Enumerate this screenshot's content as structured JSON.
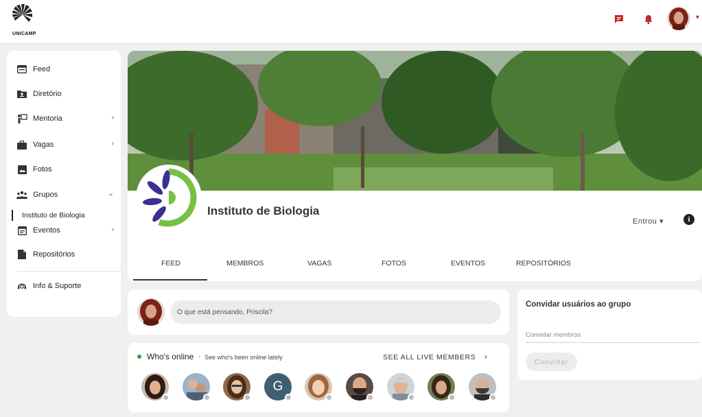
{
  "brand": {
    "name": "UNICAMP",
    "logo_icon": "unicamp-logo-icon"
  },
  "header": {
    "messages_icon": "chat-icon",
    "notifications_icon": "bell-icon",
    "accent_color": "#c62828"
  },
  "sidebar": {
    "items": [
      {
        "label": "Feed",
        "icon": "feed-icon",
        "chevron": false
      },
      {
        "label": "Diretório",
        "icon": "directory-icon",
        "chevron": false
      },
      {
        "label": "Mentoria",
        "icon": "mentoring-icon",
        "chevron": true
      },
      {
        "label": "Vagas",
        "icon": "briefcase-icon",
        "chevron": true
      },
      {
        "label": "Fotos",
        "icon": "photo-icon",
        "chevron": false
      },
      {
        "label": "Grupos",
        "icon": "groups-icon",
        "chevron": true,
        "expanded": true
      },
      {
        "label": "Eventos",
        "icon": "calendar-icon",
        "chevron": true
      },
      {
        "label": "Repositórios",
        "icon": "file-icon",
        "chevron": false
      },
      {
        "label": "Info & Suporte",
        "icon": "support-icon",
        "chevron": false
      }
    ],
    "active_subitem": "Instituto de Biologia",
    "chevron_right": "›",
    "chevron_down": "⌄"
  },
  "group": {
    "title": "Instituto de Biologia",
    "membership_label": "Entrou ▾",
    "info_label": "i",
    "tabs": [
      "FEED",
      "MEMBROS",
      "VAGAS",
      "FOTOS",
      "EVENTOS",
      "REPOSITÓRIOS"
    ],
    "active_tab": "FEED"
  },
  "composer": {
    "placeholder": "O que está pensando, Priscila?"
  },
  "online": {
    "title": "Who's online",
    "separator": "·",
    "subtitle": "See who's been online lately",
    "see_all": "SEE ALL LIVE MEMBERS",
    "see_all_chevron": "›",
    "members": [
      {
        "kind": "photo"
      },
      {
        "kind": "photo"
      },
      {
        "kind": "photo"
      },
      {
        "kind": "letter",
        "letter": "G"
      },
      {
        "kind": "photo"
      },
      {
        "kind": "photo"
      },
      {
        "kind": "photo"
      },
      {
        "kind": "photo"
      },
      {
        "kind": "photo"
      }
    ]
  },
  "invite": {
    "title": "Convidar usuários ao grupo",
    "placeholder": "Convidar membros",
    "button": "Convidar"
  }
}
